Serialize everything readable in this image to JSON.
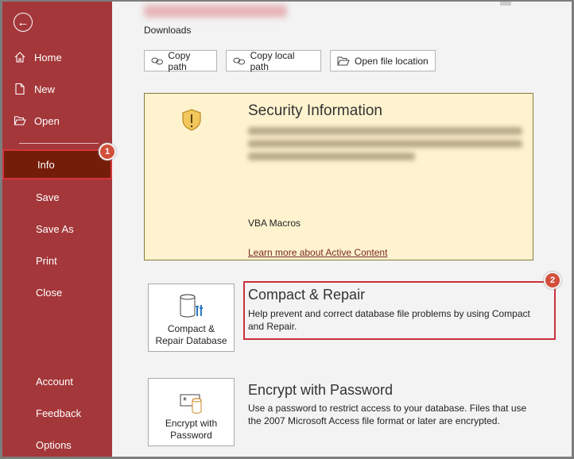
{
  "sidebar": {
    "back_icon": "arrow-left-circle-icon",
    "items": [
      {
        "label": "Home",
        "icon": "home-icon"
      },
      {
        "label": "New",
        "icon": "new-document-icon"
      },
      {
        "label": "Open",
        "icon": "folder-open-icon"
      },
      {
        "label": "Info",
        "selected": true
      },
      {
        "label": "Save"
      },
      {
        "label": "Save As"
      },
      {
        "label": "Print"
      },
      {
        "label": "Close"
      },
      {
        "label": "Account"
      },
      {
        "label": "Feedback"
      },
      {
        "label": "Options"
      }
    ],
    "color": "#a4373a",
    "selected_color": "#741d09"
  },
  "annotations": {
    "badge1": "1",
    "badge2": "2",
    "highlight_color": "#c9303a"
  },
  "location": {
    "label": "Downloads"
  },
  "buttons": {
    "copy_path": "Copy path",
    "copy_local_path": "Copy local path",
    "open_file_location": "Open file location"
  },
  "security": {
    "title": "Security Information",
    "vba": "VBA Macros",
    "learn_more": "Learn more about Active Content",
    "bg": "#fff3cf"
  },
  "compact": {
    "tile_line1": "Compact &",
    "tile_line2": "Repair Database",
    "title": "Compact & Repair",
    "desc": "Help prevent and correct database file problems by using Compact and Repair."
  },
  "encrypt": {
    "tile_line1": "Encrypt with",
    "tile_line2": "Password",
    "title": "Encrypt with Password",
    "desc": "Use a password to restrict access to your database. Files that use the 2007 Microsoft Access file format or later are encrypted."
  }
}
